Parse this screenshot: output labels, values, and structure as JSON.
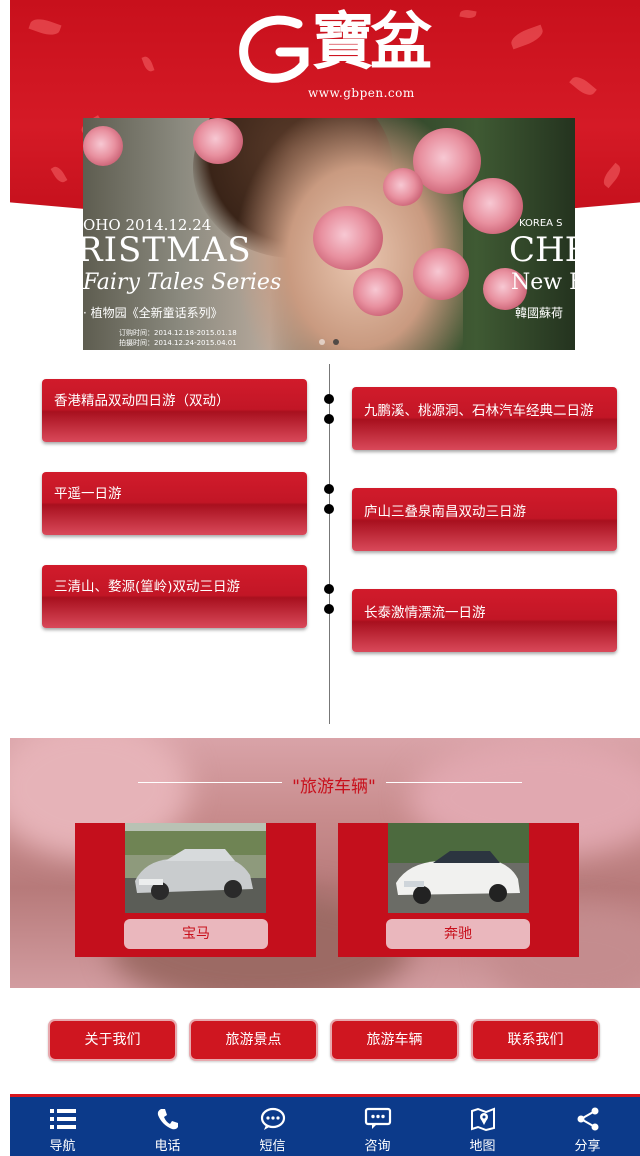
{
  "header": {
    "logo_text": "寶盆",
    "logo_url": "www.gbpen.com"
  },
  "banner": {
    "date": "OHO 2014.12.24",
    "title_left": "RISTMAS",
    "subtitle_left": "Fairy Tales Series",
    "caption_left": "· 植物园《全新童话系列》",
    "small_line_1": "订购时间：2014.12.18-2015.01.18",
    "small_line_2": "拍摄时间：2014.12.24-2015.04.01",
    "tag_right": "KOREA S",
    "title_right": "CHR",
    "subtitle_right": "New F",
    "caption_right": "韓國蘇荷",
    "slide_count": 2,
    "active_slide": 2
  },
  "routes": {
    "left": [
      {
        "label": "香港精品双动四日游（双动）"
      },
      {
        "label": "平遥一日游"
      },
      {
        "label": "三清山、婺源(篁岭)双动三日游"
      }
    ],
    "right": [
      {
        "label": "九鹏溪、桃源洞、石林汽车经典二日游"
      },
      {
        "label": "庐山三叠泉南昌双动三日游"
      },
      {
        "label": "长泰激情漂流一日游"
      }
    ]
  },
  "cars": {
    "title": "\"旅游车辆\"",
    "items": [
      {
        "label": "宝马"
      },
      {
        "label": "奔驰"
      }
    ]
  },
  "quick_links": [
    {
      "label": "关于我们"
    },
    {
      "label": "旅游景点"
    },
    {
      "label": "旅游车辆"
    },
    {
      "label": "联系我们"
    }
  ],
  "footer_nav": [
    {
      "label": "导航",
      "icon": "menu-icon"
    },
    {
      "label": "电话",
      "icon": "phone-icon"
    },
    {
      "label": "短信",
      "icon": "sms-icon"
    },
    {
      "label": "咨询",
      "icon": "chat-icon"
    },
    {
      "label": "地图",
      "icon": "map-icon"
    },
    {
      "label": "分享",
      "icon": "share-icon"
    }
  ],
  "colors": {
    "brand_red": "#c8101c",
    "footer_blue": "#0c3a8a"
  }
}
